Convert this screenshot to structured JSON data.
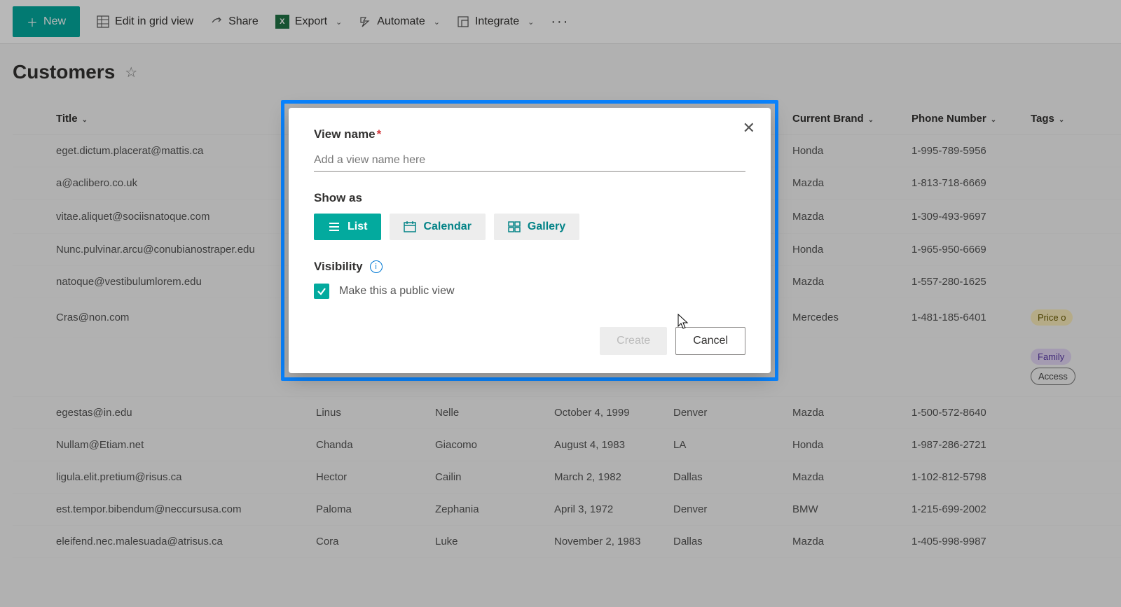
{
  "toolbar": {
    "new": "New",
    "edit_grid": "Edit in grid view",
    "share": "Share",
    "export": "Export",
    "automate": "Automate",
    "integrate": "Integrate"
  },
  "page": {
    "title": "Customers"
  },
  "columns": {
    "title": "Title",
    "brand": "Current Brand",
    "phone": "Phone Number",
    "tags": "Tags"
  },
  "rows": [
    {
      "title": "eget.dictum.placerat@mattis.ca",
      "brand": "Honda",
      "phone": "1-995-789-5956",
      "tags": []
    },
    {
      "title": "a@aclibero.co.uk",
      "brand": "Mazda",
      "phone": "1-813-718-6669",
      "tags": []
    },
    {
      "title": "vitae.aliquet@sociisnatoque.com",
      "brand": "Mazda",
      "phone": "1-309-493-9697",
      "tags": [],
      "comment": true
    },
    {
      "title": "Nunc.pulvinar.arcu@conubianostraper.edu",
      "brand": "Honda",
      "phone": "1-965-950-6669",
      "tags": []
    },
    {
      "title": "natoque@vestibulumlorem.edu",
      "brand": "Mazda",
      "phone": "1-557-280-1625",
      "tags": []
    },
    {
      "title": "Cras@non.com",
      "brand": "Mercedes",
      "phone": "1-481-185-6401",
      "tags": [
        "Price o"
      ]
    },
    {
      "title": "",
      "brand": "",
      "phone": "",
      "tags": [
        "Family",
        "Access"
      ]
    },
    {
      "title": "egestas@in.edu",
      "f1": "Linus",
      "f2": "Nelle",
      "f3": "October 4, 1999",
      "f4": "Denver",
      "brand": "Mazda",
      "phone": "1-500-572-8640",
      "tags": []
    },
    {
      "title": "Nullam@Etiam.net",
      "f1": "Chanda",
      "f2": "Giacomo",
      "f3": "August 4, 1983",
      "f4": "LA",
      "brand": "Honda",
      "phone": "1-987-286-2721",
      "tags": []
    },
    {
      "title": "ligula.elit.pretium@risus.ca",
      "f1": "Hector",
      "f2": "Cailin",
      "f3": "March 2, 1982",
      "f4": "Dallas",
      "brand": "Mazda",
      "phone": "1-102-812-5798",
      "tags": []
    },
    {
      "title": "est.tempor.bibendum@neccursusa.com",
      "f1": "Paloma",
      "f2": "Zephania",
      "f3": "April 3, 1972",
      "f4": "Denver",
      "brand": "BMW",
      "phone": "1-215-699-2002",
      "tags": []
    },
    {
      "title": "eleifend.nec.malesuada@atrisus.ca",
      "f1": "Cora",
      "f2": "Luke",
      "f3": "November 2, 1983",
      "f4": "Dallas",
      "brand": "Mazda",
      "phone": "1-405-998-9987",
      "tags": []
    }
  ],
  "pill_classes": {
    "Price o": "pill-yellow",
    "Family": "pill-purple",
    "Access": "pill-outline"
  },
  "modal": {
    "view_name_label": "View name",
    "view_name_placeholder": "Add a view name here",
    "show_as_label": "Show as",
    "opt_list": "List",
    "opt_calendar": "Calendar",
    "opt_gallery": "Gallery",
    "visibility_label": "Visibility",
    "public_checkbox": "Make this a public view",
    "create": "Create",
    "cancel": "Cancel"
  }
}
